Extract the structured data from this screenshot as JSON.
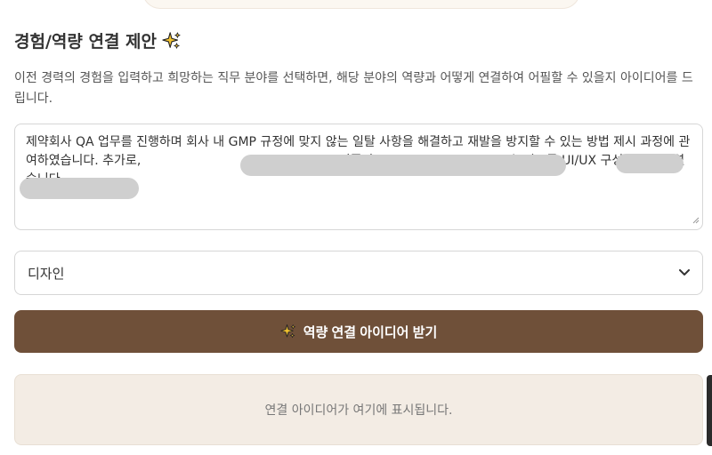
{
  "section": {
    "title": "경험/역량 연결 제안",
    "title_icon": "sparkle-icon",
    "description": "이전 경력의 경험을 입력하고 희망하는 직무 분야를 선택하면, 해당 분야의 역량과 어떻게 연결하여 어필할 수 있을지 아이디어를 드립니다."
  },
  "experience": {
    "value": "제약회사 QA 업무를 진행하며 회사 내 GMP 규정에 맞지 않는 일탈 사항을 해결하고 재발을 방지할 수 있는 방법 제시 과정에 관여하였습니다. 추가로,                                                  기존의                                  수 있도록 UI/UX 구성에 관여하였습니다."
  },
  "field_select": {
    "selected": "디자인",
    "icon": "chevron-down-icon"
  },
  "submit": {
    "label": "역량 연결 아이디어 받기",
    "icon": "sparkle-icon"
  },
  "result": {
    "placeholder": "연결 아이디어가 여기에 표시됩니다."
  },
  "colors": {
    "button": "#6f5039",
    "result_bg": "#f3ece4",
    "sparkle": "#f2c230"
  }
}
